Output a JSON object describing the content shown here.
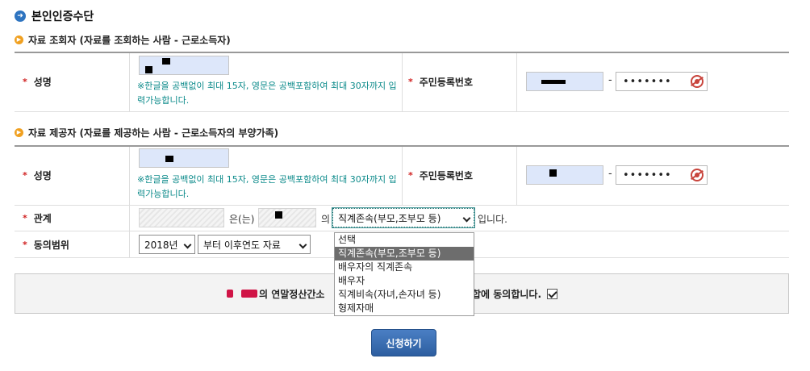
{
  "page": {
    "title": "본인인증수단"
  },
  "section1": {
    "heading": "자료 조회자 (자료를 조회하는 사람 - 근로소득자)",
    "name_label": "성명",
    "hint": "※한글을 공백없이 최대 15자, 영문은 공백포함하여 최대 30자까지 입력가능합니다.",
    "rrn_label": "주민등록번호",
    "rrn_dash": "-",
    "rrn_back": "•••••••"
  },
  "section2": {
    "heading": "자료 제공자 (자료를 제공하는 사람 - 근로소득자의 부양가족)",
    "name_label": "성명",
    "hint": "※한글을 공백없이 최대 15자, 영문은 공백포함하여 최대 30자까지 입력가능합니다.",
    "rrn_label": "주민등록번호",
    "rrn_dash": "-",
    "rrn_back": "•••••••",
    "relation_label": "관계",
    "relation_particle1": "은(는)",
    "relation_particle2": "의",
    "relation_selected": "직계존속(부모,조부모 등)",
    "relation_suffix": "입니다.",
    "relation_options": [
      "선택",
      "직계존속(부모,조부모 등)",
      "배우자의 직계존속",
      "배우자",
      "직계비속(자녀,손자녀 등)",
      "형제자매"
    ],
    "consent_label": "동의범위",
    "consent_year": "2018년",
    "consent_scope": "부터 이후연도 자료"
  },
  "consent": {
    "text_left": "의 연말정산간소",
    "text_right": "합에 동의합니다.",
    "checked": true
  },
  "submit_label": "신청하기"
}
